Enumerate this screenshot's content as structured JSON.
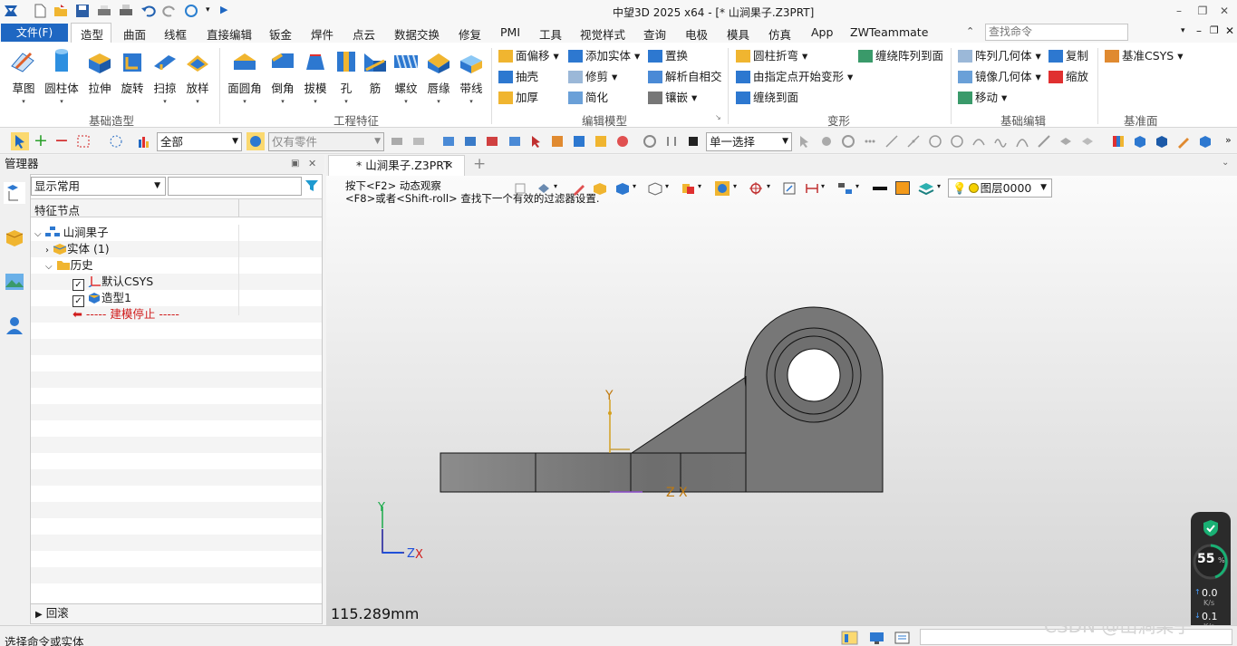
{
  "window": {
    "title": "中望3D 2025 x64 - [* 山涧果子.Z3PRT]"
  },
  "ribbon_tabs": [
    "造型",
    "曲面",
    "线框",
    "直接编辑",
    "钣金",
    "焊件",
    "点云",
    "数据交换",
    "修复",
    "PMI",
    "工具",
    "视觉样式",
    "查询",
    "电极",
    "模具",
    "仿真",
    "App",
    "ZWTeammate"
  ],
  "file_tab": "文件(F)",
  "search": {
    "placeholder": "查找命令"
  },
  "ribbon": {
    "basic": {
      "label": "基础造型",
      "buttons": [
        "草图",
        "圆柱体",
        "拉伸",
        "旋转",
        "扫掠",
        "放样"
      ]
    },
    "eng": {
      "label": "工程特征",
      "buttons": [
        "面圆角",
        "倒角",
        "拔模",
        "孔",
        "筋",
        "螺纹",
        "唇缘",
        "带线"
      ]
    },
    "edit": {
      "label": "编辑模型",
      "col1": [
        "面偏移",
        "抽壳",
        "加厚"
      ],
      "col2": [
        "添加实体",
        "修剪",
        "简化"
      ],
      "col3": [
        "置换",
        "解析自相交",
        "镶嵌"
      ]
    },
    "deform": {
      "label": "变形",
      "col1": [
        "圆柱折弯",
        "由指定点开始变形",
        "缠绕到面"
      ],
      "col2": [
        "缠绕阵列到面"
      ]
    },
    "basicedit": {
      "label": "基础编辑",
      "col1": [
        "阵列几何体",
        "镜像几何体",
        "移动"
      ],
      "col2": [
        "复制",
        "缩放"
      ]
    },
    "datum": {
      "label": "基准面",
      "csys": "基准CSYS"
    }
  },
  "toolbar": {
    "filter": "全部",
    "parts": "仅有零件",
    "selmode": "单一选择"
  },
  "manager": {
    "title": "管理器",
    "display": "显示常用",
    "column": "特征节点",
    "tree": {
      "root": "山涧果子",
      "solid": "实体 (1)",
      "history": "历史",
      "csys": "默认CSYS",
      "shape": "造型1",
      "stop": "----- 建模停止 -----"
    },
    "rollback": "回滚"
  },
  "doc_tab": "* 山涧果子.Z3PRT",
  "viewport": {
    "hint1": "按下<F2> 动态观察",
    "hint2": "<F8>或者<Shift-roll> 查找下一个有效的过滤器设置.",
    "layer": "图层0000",
    "measure": "115.289mm",
    "axis_y": "Y",
    "axis_z": "Z",
    "axis_x": "X"
  },
  "net": {
    "percent": "55",
    "pct_sign": "%",
    "up": "0.0",
    "up_unit": "K/s",
    "down": "0.1",
    "down_unit": "K/s"
  },
  "status": {
    "text": "选择命令或实体",
    "watermark": "CSDN @山涧果子"
  }
}
